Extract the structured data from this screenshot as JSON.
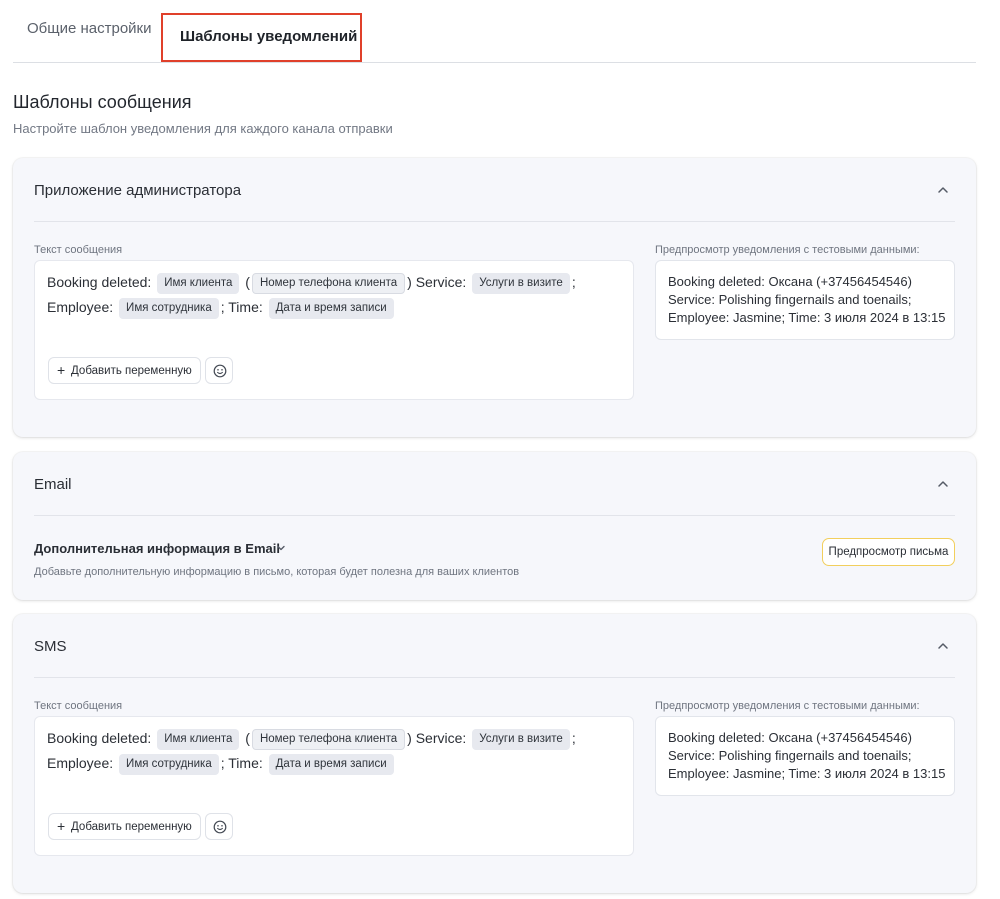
{
  "tabs": {
    "general": "Общие настройки",
    "templates": "Шаблоны уведомлений"
  },
  "header": {
    "title": "Шаблоны сообщения",
    "subtitle": "Настройте шаблон уведомления для каждого канала отправки"
  },
  "admin": {
    "title": "Приложение администратора",
    "message_label": "Текст сообщения",
    "preview_label": "Предпросмотр уведомления с тестовыми данными:",
    "template": {
      "t1": "Booking deleted:",
      "chip_client_name": "Имя клиента",
      "t2": "(",
      "chip_client_phone": "Номер телефона клиента",
      "t3": ") Service:",
      "chip_services": "Услуги в визите",
      "t4": "; Employee:",
      "chip_employee": "Имя сотрудника",
      "t5": "; Time:",
      "chip_datetime": "Дата и время записи"
    },
    "add_variable": "Добавить переменную",
    "preview_lines": [
      "Booking deleted: Оксана (+37456454546)",
      "Service: Polishing fingernails and toenails;",
      "Employee: Jasmine; Time: 3 июля 2024 в 13:15"
    ]
  },
  "email": {
    "title": "Email",
    "info_title": "Дополнительная информация в Email",
    "info_desc": "Добавьте дополнительную информацию в письмо, которая будет полезна для ваших клиентов",
    "preview_button": "Предпросмотр письма"
  },
  "sms": {
    "title": "SMS",
    "message_label": "Текст сообщения",
    "preview_label": "Предпросмотр уведомления с тестовыми данными:",
    "template": {
      "t1": "Booking deleted:",
      "chip_client_name": "Имя клиента",
      "t2": "(",
      "chip_client_phone": "Номер телефона клиента",
      "t3": ") Service:",
      "chip_services": "Услуги в визите",
      "t4": "; Employee:",
      "chip_employee": "Имя сотрудника",
      "t5": "; Time:",
      "chip_datetime": "Дата и время записи"
    },
    "add_variable": "Добавить переменную",
    "preview_lines": [
      "Booking deleted: Оксана (+37456454546)",
      "Service: Polishing fingernails and toenails;",
      "Employee: Jasmine; Time: 3 июля 2024 в 13:15"
    ]
  },
  "icons": {
    "collapse": "chevron-up-icon",
    "expand": "chevron-down-icon",
    "add": "plus-icon",
    "emoji": "smiley-icon"
  },
  "colors": {
    "active_tab_border": "#e0402a",
    "preview_button_border": "#f2cf5d",
    "card_background": "#f6f7fb"
  }
}
